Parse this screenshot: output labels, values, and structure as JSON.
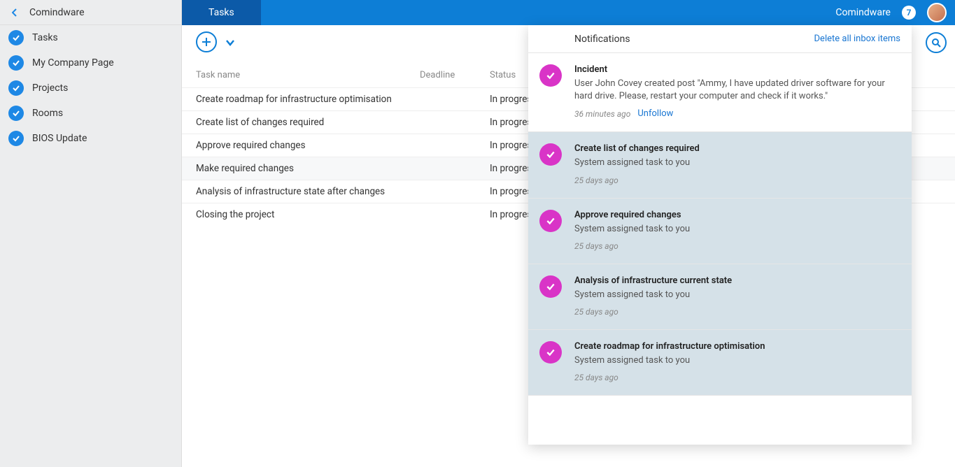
{
  "sidebar": {
    "title": "Comindware",
    "items": [
      {
        "label": "Tasks"
      },
      {
        "label": "My Company Page"
      },
      {
        "label": "Projects"
      },
      {
        "label": "Rooms"
      },
      {
        "label": "BIOS Update"
      }
    ]
  },
  "header": {
    "active_tab": "Tasks",
    "user": "Comindware",
    "badge": "7"
  },
  "table": {
    "columns": {
      "name": "Task name",
      "deadline": "Deadline",
      "status": "Status"
    },
    "rows": [
      {
        "name": "Create roadmap for infrastructure optimisation",
        "deadline": "",
        "status": "In progress"
      },
      {
        "name": "Create list of changes required",
        "deadline": "",
        "status": "In progress"
      },
      {
        "name": "Approve required changes",
        "deadline": "",
        "status": "In progress"
      },
      {
        "name": "Make required changes",
        "deadline": "",
        "status": "In progress"
      },
      {
        "name": "Analysis of infrastructure state after changes",
        "deadline": "",
        "status": "In progress"
      },
      {
        "name": "Closing the project",
        "deadline": "",
        "status": "In progress"
      }
    ]
  },
  "notifications": {
    "title": "Notifications",
    "delete_label": "Delete all inbox items",
    "items": [
      {
        "title": "Incident",
        "body": "User John Covey created post \"Ammy, I have updated driver software for your hard drive. Please, restart your computer and check if it works.\"",
        "time": "36 minutes ago",
        "unfollow": "Unfollow",
        "read": false
      },
      {
        "title": "Create list of changes required",
        "body": "System assigned task to you",
        "time": "25 days ago",
        "read": true
      },
      {
        "title": "Approve required changes",
        "body": "System assigned task to you",
        "time": "25 days ago",
        "read": true
      },
      {
        "title": "Analysis of infrastructure current state",
        "body": "System assigned task to you",
        "time": "25 days ago",
        "read": true
      },
      {
        "title": "Create roadmap for infrastructure optimisation",
        "body": "System assigned task to you",
        "time": "25 days ago",
        "read": true
      }
    ]
  }
}
